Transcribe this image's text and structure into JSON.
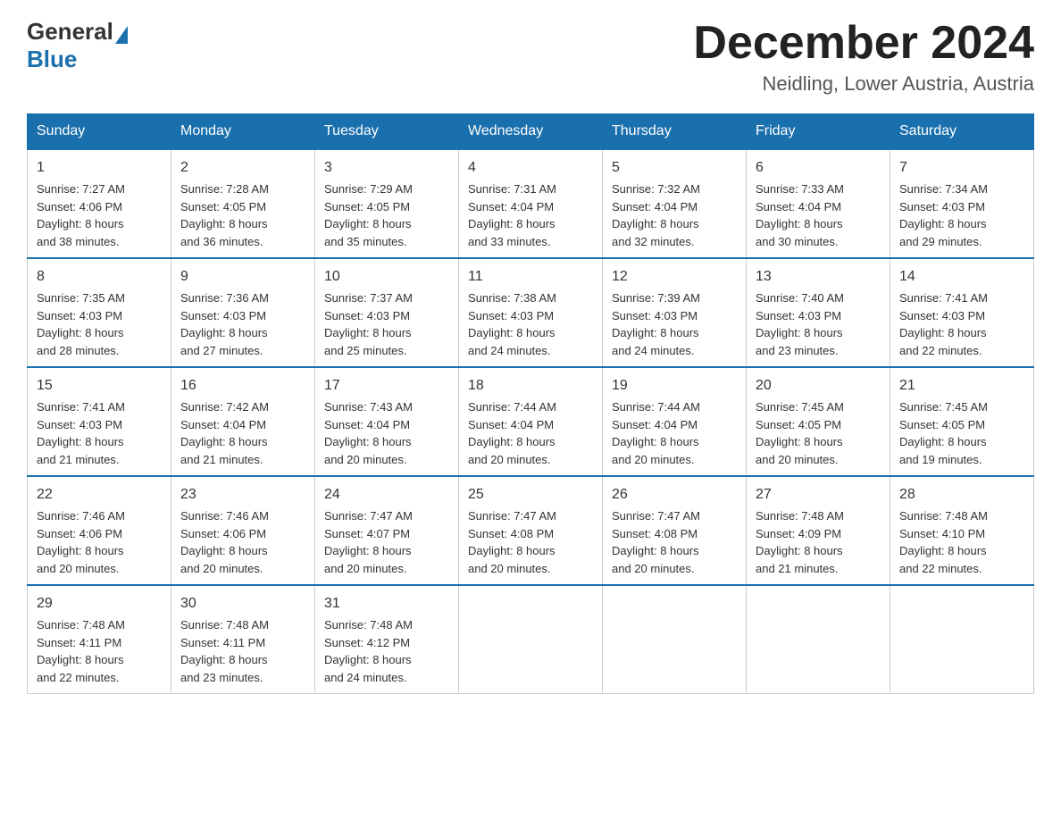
{
  "header": {
    "logo_general": "General",
    "logo_blue": "Blue",
    "month_title": "December 2024",
    "location": "Neidling, Lower Austria, Austria"
  },
  "days_of_week": [
    "Sunday",
    "Monday",
    "Tuesday",
    "Wednesday",
    "Thursday",
    "Friday",
    "Saturday"
  ],
  "weeks": [
    [
      {
        "day": "1",
        "sunrise": "7:27 AM",
        "sunset": "4:06 PM",
        "daylight": "8 hours and 38 minutes."
      },
      {
        "day": "2",
        "sunrise": "7:28 AM",
        "sunset": "4:05 PM",
        "daylight": "8 hours and 36 minutes."
      },
      {
        "day": "3",
        "sunrise": "7:29 AM",
        "sunset": "4:05 PM",
        "daylight": "8 hours and 35 minutes."
      },
      {
        "day": "4",
        "sunrise": "7:31 AM",
        "sunset": "4:04 PM",
        "daylight": "8 hours and 33 minutes."
      },
      {
        "day": "5",
        "sunrise": "7:32 AM",
        "sunset": "4:04 PM",
        "daylight": "8 hours and 32 minutes."
      },
      {
        "day": "6",
        "sunrise": "7:33 AM",
        "sunset": "4:04 PM",
        "daylight": "8 hours and 30 minutes."
      },
      {
        "day": "7",
        "sunrise": "7:34 AM",
        "sunset": "4:03 PM",
        "daylight": "8 hours and 29 minutes."
      }
    ],
    [
      {
        "day": "8",
        "sunrise": "7:35 AM",
        "sunset": "4:03 PM",
        "daylight": "8 hours and 28 minutes."
      },
      {
        "day": "9",
        "sunrise": "7:36 AM",
        "sunset": "4:03 PM",
        "daylight": "8 hours and 27 minutes."
      },
      {
        "day": "10",
        "sunrise": "7:37 AM",
        "sunset": "4:03 PM",
        "daylight": "8 hours and 25 minutes."
      },
      {
        "day": "11",
        "sunrise": "7:38 AM",
        "sunset": "4:03 PM",
        "daylight": "8 hours and 24 minutes."
      },
      {
        "day": "12",
        "sunrise": "7:39 AM",
        "sunset": "4:03 PM",
        "daylight": "8 hours and 24 minutes."
      },
      {
        "day": "13",
        "sunrise": "7:40 AM",
        "sunset": "4:03 PM",
        "daylight": "8 hours and 23 minutes."
      },
      {
        "day": "14",
        "sunrise": "7:41 AM",
        "sunset": "4:03 PM",
        "daylight": "8 hours and 22 minutes."
      }
    ],
    [
      {
        "day": "15",
        "sunrise": "7:41 AM",
        "sunset": "4:03 PM",
        "daylight": "8 hours and 21 minutes."
      },
      {
        "day": "16",
        "sunrise": "7:42 AM",
        "sunset": "4:04 PM",
        "daylight": "8 hours and 21 minutes."
      },
      {
        "day": "17",
        "sunrise": "7:43 AM",
        "sunset": "4:04 PM",
        "daylight": "8 hours and 20 minutes."
      },
      {
        "day": "18",
        "sunrise": "7:44 AM",
        "sunset": "4:04 PM",
        "daylight": "8 hours and 20 minutes."
      },
      {
        "day": "19",
        "sunrise": "7:44 AM",
        "sunset": "4:04 PM",
        "daylight": "8 hours and 20 minutes."
      },
      {
        "day": "20",
        "sunrise": "7:45 AM",
        "sunset": "4:05 PM",
        "daylight": "8 hours and 20 minutes."
      },
      {
        "day": "21",
        "sunrise": "7:45 AM",
        "sunset": "4:05 PM",
        "daylight": "8 hours and 19 minutes."
      }
    ],
    [
      {
        "day": "22",
        "sunrise": "7:46 AM",
        "sunset": "4:06 PM",
        "daylight": "8 hours and 20 minutes."
      },
      {
        "day": "23",
        "sunrise": "7:46 AM",
        "sunset": "4:06 PM",
        "daylight": "8 hours and 20 minutes."
      },
      {
        "day": "24",
        "sunrise": "7:47 AM",
        "sunset": "4:07 PM",
        "daylight": "8 hours and 20 minutes."
      },
      {
        "day": "25",
        "sunrise": "7:47 AM",
        "sunset": "4:08 PM",
        "daylight": "8 hours and 20 minutes."
      },
      {
        "day": "26",
        "sunrise": "7:47 AM",
        "sunset": "4:08 PM",
        "daylight": "8 hours and 20 minutes."
      },
      {
        "day": "27",
        "sunrise": "7:48 AM",
        "sunset": "4:09 PM",
        "daylight": "8 hours and 21 minutes."
      },
      {
        "day": "28",
        "sunrise": "7:48 AM",
        "sunset": "4:10 PM",
        "daylight": "8 hours and 22 minutes."
      }
    ],
    [
      {
        "day": "29",
        "sunrise": "7:48 AM",
        "sunset": "4:11 PM",
        "daylight": "8 hours and 22 minutes."
      },
      {
        "day": "30",
        "sunrise": "7:48 AM",
        "sunset": "4:11 PM",
        "daylight": "8 hours and 23 minutes."
      },
      {
        "day": "31",
        "sunrise": "7:48 AM",
        "sunset": "4:12 PM",
        "daylight": "8 hours and 24 minutes."
      },
      null,
      null,
      null,
      null
    ]
  ]
}
